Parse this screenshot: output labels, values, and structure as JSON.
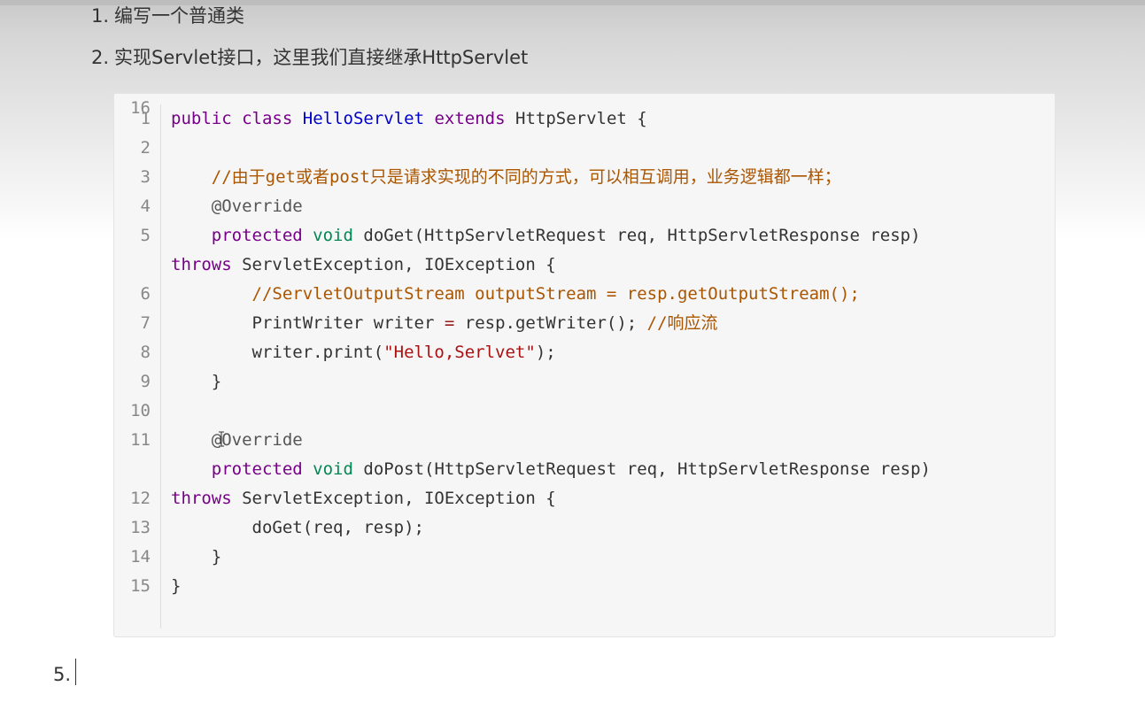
{
  "list": {
    "items": [
      {
        "num": "1.",
        "text": "编写一个普通类"
      },
      {
        "num": "2.",
        "text": "实现Servlet接口，这里我们直接继承HttpServlet"
      }
    ],
    "next_num": "5."
  },
  "code": {
    "line_numbers": [
      "1",
      "2",
      "3",
      "4",
      "5",
      "6",
      "7",
      "8",
      "9",
      "10",
      "11",
      "12",
      "13",
      "14",
      "15",
      "16"
    ],
    "lines": [
      [
        {
          "t": "public",
          "c": "kw"
        },
        {
          "t": " ",
          "c": ""
        },
        {
          "t": "class",
          "c": "kw"
        },
        {
          "t": " ",
          "c": ""
        },
        {
          "t": "HelloServlet",
          "c": "def"
        },
        {
          "t": " ",
          "c": ""
        },
        {
          "t": "extends",
          "c": "kw"
        },
        {
          "t": " HttpServlet {",
          "c": ""
        }
      ],
      [],
      [
        {
          "t": "    ",
          "c": ""
        },
        {
          "t": "//由于get或者post只是请求实现的不同的方式，可以相互调用，业务逻辑都一样；",
          "c": "cm"
        }
      ],
      [
        {
          "t": "    ",
          "c": ""
        },
        {
          "t": "@Override",
          "c": "meta"
        }
      ],
      [
        {
          "t": "    ",
          "c": ""
        },
        {
          "t": "protected",
          "c": "kw"
        },
        {
          "t": " ",
          "c": ""
        },
        {
          "t": "void",
          "c": "var3"
        },
        {
          "t": " doGet(HttpServletRequest req, HttpServletResponse resp)",
          "c": ""
        }
      ],
      [
        {
          "t": "throws",
          "c": "kw"
        },
        {
          "t": " ServletException, IOException {",
          "c": ""
        }
      ],
      [
        {
          "t": "        ",
          "c": ""
        },
        {
          "t": "//ServletOutputStream outputStream = resp.getOutputStream();",
          "c": "cm"
        }
      ],
      [
        {
          "t": "        PrintWriter writer ",
          "c": ""
        },
        {
          "t": "=",
          "c": "op"
        },
        {
          "t": " resp.getWriter(); ",
          "c": ""
        },
        {
          "t": "//响应流",
          "c": "cm"
        }
      ],
      [
        {
          "t": "        writer.print(",
          "c": ""
        },
        {
          "t": "\"Hello,Serlvet\"",
          "c": "str"
        },
        {
          "t": ");",
          "c": ""
        }
      ],
      [
        {
          "t": "    }",
          "c": ""
        }
      ],
      [],
      [
        {
          "t": "    ",
          "c": ""
        },
        {
          "t": "@Override",
          "c": "meta"
        }
      ],
      [
        {
          "t": "    ",
          "c": ""
        },
        {
          "t": "protected",
          "c": "kw"
        },
        {
          "t": " ",
          "c": ""
        },
        {
          "t": "void",
          "c": "var3"
        },
        {
          "t": " doPost(HttpServletRequest req, HttpServletResponse resp)",
          "c": ""
        }
      ],
      [
        {
          "t": "throws",
          "c": "kw"
        },
        {
          "t": " ServletException, IOException {",
          "c": ""
        }
      ],
      [
        {
          "t": "        doGet(req, resp);",
          "c": ""
        }
      ],
      [
        {
          "t": "    }",
          "c": ""
        }
      ],
      [
        {
          "t": "}",
          "c": ""
        }
      ],
      []
    ]
  }
}
